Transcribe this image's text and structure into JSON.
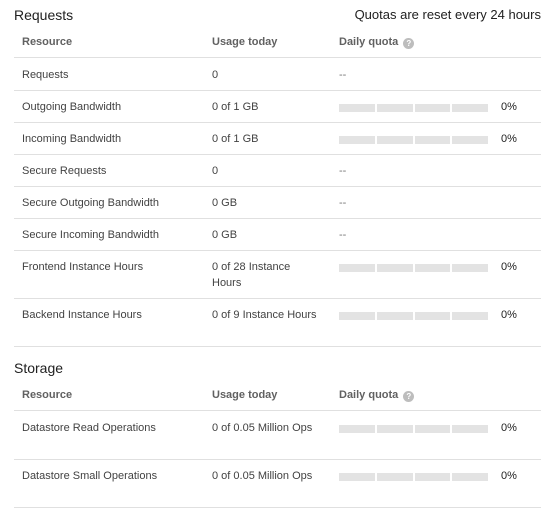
{
  "requests": {
    "title": "Requests",
    "reset_note": "Quotas are reset every 24 hours",
    "columns": {
      "resource": "Resource",
      "usage": "Usage today",
      "quota": "Daily quota"
    },
    "rows": [
      {
        "resource": "Requests",
        "usage": "0",
        "quota_text": "--"
      },
      {
        "resource": "Outgoing Bandwidth",
        "usage": "0 of 1 GB",
        "percent": "0%",
        "fill": 0
      },
      {
        "resource": "Incoming Bandwidth",
        "usage": "0 of 1 GB",
        "percent": "0%",
        "fill": 0
      },
      {
        "resource": "Secure Requests",
        "usage": "0",
        "quota_text": "--"
      },
      {
        "resource": "Secure Outgoing Bandwidth",
        "usage": "0 GB",
        "quota_text": "--"
      },
      {
        "resource": "Secure Incoming Bandwidth",
        "usage": "0 GB",
        "quota_text": "--"
      },
      {
        "resource": "Frontend Instance Hours",
        "usage": "0 of 28 Instance Hours",
        "percent": "0%",
        "fill": 0
      },
      {
        "resource": "Backend Instance Hours",
        "usage": "0 of 9 Instance Hours",
        "percent": "0%",
        "fill": 0
      }
    ]
  },
  "storage": {
    "title": "Storage",
    "columns": {
      "resource": "Resource",
      "usage": "Usage today",
      "quota": "Daily quota"
    },
    "rows": [
      {
        "resource": "Datastore Read Operations",
        "usage": "0 of 0.05 Million Ops",
        "percent": "0%",
        "fill": 0
      },
      {
        "resource": "Datastore Small Operations",
        "usage": "0 of 0.05 Million Ops",
        "percent": "0%",
        "fill": 0
      }
    ]
  },
  "help_icon": "help-icon",
  "colors": {
    "bar_track": "#e3e3e3",
    "bar_fill": "#4285f4",
    "divider": "#e0e0e0"
  }
}
